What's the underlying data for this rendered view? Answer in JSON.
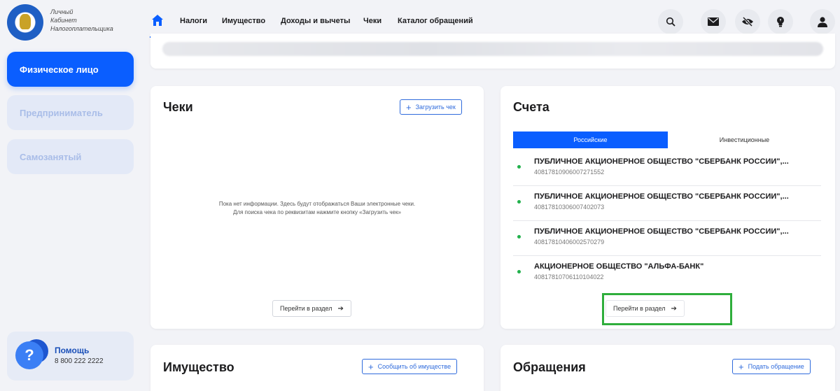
{
  "logo": {
    "line1": "Личный",
    "line2": "Кабинет",
    "line3": "Налогоплательщика"
  },
  "sidebar": {
    "items": [
      {
        "label": "Физическое лицо",
        "state": "active"
      },
      {
        "label": "Предприниматель",
        "state": "inactive"
      },
      {
        "label": "Самозанятый",
        "state": "inactive"
      }
    ],
    "help": {
      "title": "Помощь",
      "phone": "8 800 222 2222"
    }
  },
  "nav": {
    "items": [
      "Налоги",
      "Имущество",
      "Доходы и вычеты",
      "Чеки",
      "Каталог обращений"
    ],
    "icons": [
      "search-icon",
      "mail-icon",
      "eye-off-icon",
      "lightbulb-icon",
      "user-icon"
    ]
  },
  "checks_card": {
    "title": "Чеки",
    "upload_label": "Загрузить чек",
    "empty_line1": "Пока нет информации. Здесь будут отображаться Ваши электронные чеки.",
    "empty_line2": "Для поиска чека по реквизитам нажмите кнопку «Загрузить чек»",
    "go_label": "Перейти в раздел"
  },
  "accounts_card": {
    "title": "Счета",
    "tabs": [
      "Российские",
      "Инвестиционные"
    ],
    "accounts": [
      {
        "name": "ПУБЛИЧНОЕ АКЦИОНЕРНОЕ ОБЩЕСТВО \"СБЕРБАНК РОССИИ\",...",
        "number": "40817810906007271552"
      },
      {
        "name": "ПУБЛИЧНОЕ АКЦИОНЕРНОЕ ОБЩЕСТВО \"СБЕРБАНК РОССИИ\",...",
        "number": "40817810306007402073"
      },
      {
        "name": "ПУБЛИЧНОЕ АКЦИОНЕРНОЕ ОБЩЕСТВО \"СБЕРБАНК РОССИИ\",...",
        "number": "40817810406002570279"
      },
      {
        "name": "АКЦИОНЕРНОЕ ОБЩЕСТВО \"АЛЬФА-БАНК\"",
        "number": "40817810706110104022"
      }
    ],
    "go_label": "Перейти в раздел"
  },
  "property_card": {
    "title": "Имущество",
    "action_label": "Сообщить об имуществе"
  },
  "appeals_card": {
    "title": "Обращения",
    "action_label": "Подать обращение"
  },
  "colors": {
    "accent": "#0a5eff",
    "highlight": "#2fae3c",
    "status_dot": "#22b14c"
  }
}
